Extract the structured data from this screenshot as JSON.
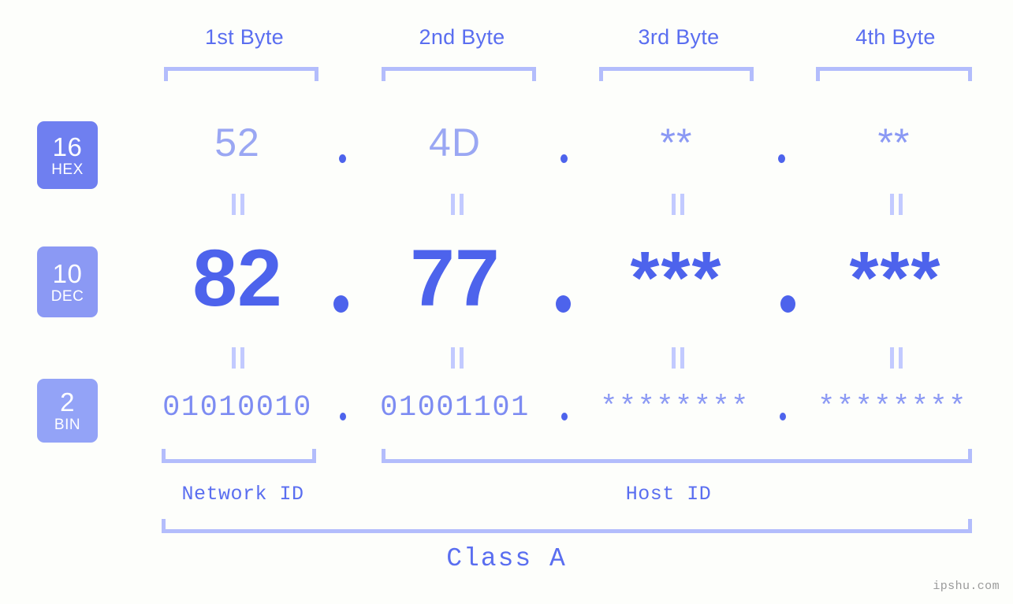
{
  "watermark": "ipshu.com",
  "headers": [
    {
      "label": "1st Byte"
    },
    {
      "label": "2nd Byte"
    },
    {
      "label": "3rd Byte"
    },
    {
      "label": "4th Byte"
    }
  ],
  "bases": [
    {
      "number": "16",
      "name": "HEX",
      "color": "#6f7ff0"
    },
    {
      "number": "10",
      "name": "DEC",
      "color": "#8b99f4"
    },
    {
      "number": "2",
      "name": "BIN",
      "color": "#93a3f7"
    }
  ],
  "rows": {
    "hex": {
      "base_number": "16",
      "base_name": "HEX",
      "values": [
        "52",
        "4D",
        "**",
        "**"
      ],
      "separator": "."
    },
    "dec": {
      "base_number": "10",
      "base_name": "DEC",
      "values": [
        "82",
        "77",
        "***",
        "***"
      ],
      "separator": "."
    },
    "bin": {
      "base_number": "2",
      "base_name": "BIN",
      "values": [
        "01010010",
        "01001101",
        "********",
        "********"
      ],
      "separator": "."
    }
  },
  "equals_symbol": "||",
  "segments": {
    "network_id": "Network ID",
    "host_id": "Host ID",
    "class": "Class A"
  },
  "colors": {
    "background": "#fdfefb",
    "accent_strong": "#4d63ec",
    "accent_mid": "#5a6ef0",
    "accent_light": "#8b99f4",
    "bracket": "#b3bdfc",
    "equals_bar": "#c2caff",
    "watermark": "#9a9a9a"
  }
}
